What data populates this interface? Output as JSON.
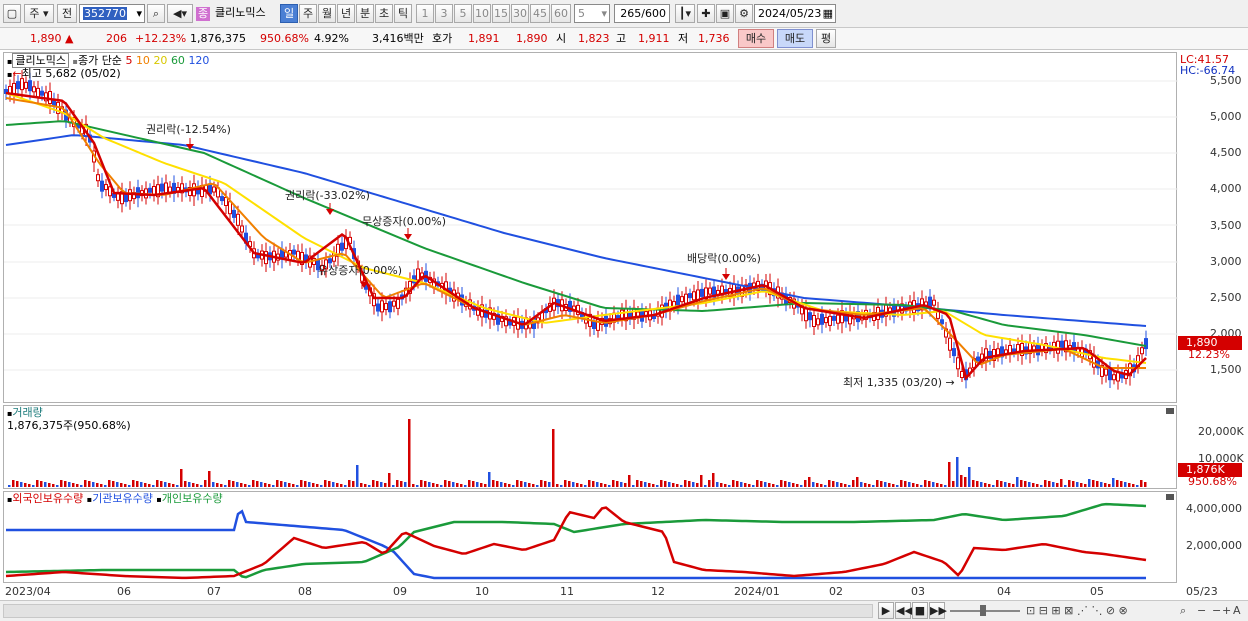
{
  "toolbar": {
    "market": "주",
    "prev_label": "전",
    "code": "352770",
    "stock_name": "클리노믹스",
    "stock_badge": "종",
    "period_buttons": [
      "일",
      "주",
      "월",
      "년",
      "분",
      "초",
      "틱"
    ],
    "interval_buttons": [
      "1",
      "3",
      "5",
      "10",
      "15",
      "30",
      "45",
      "60"
    ],
    "count_value": "5",
    "range_display": "265",
    "range_total": "/600",
    "date_value": "2024/05/23"
  },
  "quote": {
    "price": "1,890",
    "change": "206",
    "change_pct": "+12.23%",
    "volume": "1,876,375",
    "volume_ratio": "950.68%",
    "turnover": "4.92%",
    "amount": "3,416백만",
    "bid_label": "호가",
    "bid1": "1,891",
    "bid2": "1,890",
    "open_label": "시",
    "open": "1,823",
    "high_label": "고",
    "high": "1,911",
    "low_label": "저",
    "low": "1,736",
    "buy_label": "매수",
    "sell_label": "매도",
    "eval_label": "평"
  },
  "price_panel": {
    "title": "클리노믹스",
    "legend_prefix": "종가 단순",
    "ma": [
      {
        "period": "5",
        "color": "#d40000"
      },
      {
        "period": "10",
        "color": "#f08000"
      },
      {
        "period": "20",
        "color": "#e8d800"
      },
      {
        "period": "60",
        "color": "#1a9a3a"
      },
      {
        "period": "120",
        "color": "#2050e0"
      }
    ],
    "high_note": "최고 5,682 (05/02)",
    "low_note": "최저 1,335 (03/20)",
    "annotations": [
      "권리락(-12.54%)",
      "권리락(-33.02%)",
      "무상증자(0.00%)",
      "유상증자(0.00%)",
      "배당락(0.00%)"
    ],
    "lc": "LC:41.57",
    "hc": "HC:-66.74",
    "yticks": [
      "5,500",
      "5,000",
      "4,500",
      "4,000",
      "3,500",
      "3,000",
      "2,500",
      "2,000",
      "1,500"
    ],
    "current_tag": "1,890",
    "current_pct": "12.23%"
  },
  "volume_panel": {
    "title": "거래량",
    "value": "1,876,375주(950.68%)",
    "yticks": [
      "20,000K",
      "10,000K"
    ],
    "current_tag": "1,876K",
    "current_pct": "950.68%"
  },
  "holdings_panel": {
    "series": [
      {
        "name": "외국인보유수량",
        "color": "#d40000"
      },
      {
        "name": "기관보유수량",
        "color": "#2050e0"
      },
      {
        "name": "개인보유수량",
        "color": "#1a9a3a"
      }
    ],
    "yticks": [
      "4,000,000",
      "2,000,000"
    ]
  },
  "x_axis": [
    "2023/04",
    "06",
    "07",
    "08",
    "09",
    "10",
    "11",
    "12",
    "2024/01",
    "02",
    "03",
    "04",
    "05",
    "05/23"
  ]
}
